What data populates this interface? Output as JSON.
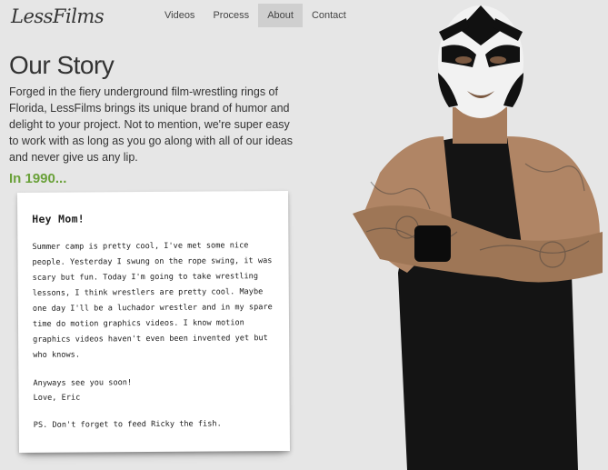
{
  "brand": {
    "logo_text": "LessFilms"
  },
  "nav": {
    "items": [
      {
        "label": "Videos",
        "active": false
      },
      {
        "label": "Process",
        "active": false
      },
      {
        "label": "About",
        "active": true
      },
      {
        "label": "Contact",
        "active": false
      }
    ]
  },
  "page": {
    "title": "Our Story",
    "intro": "Forged in the fiery underground film-wrestling rings of Florida, LessFilms brings its unique brand of humor and delight to your project. Not to mention, we're super easy to work with as long as you go along with all of our ideas and never give us any lip.",
    "year_heading": "In 1990..."
  },
  "letter": {
    "greeting": "Hey Mom!",
    "body": "Summer camp is pretty cool, I've met some nice people. Yesterday I swung on the rope swing, it was scary but fun. Today I'm going to take wrestling lessons, I think wrestlers are pretty cool. Maybe one day I'll be a luchador wrestler and in my spare time do motion graphics videos. I know motion graphics videos haven't even been invented yet but who knows.",
    "closing": "Anyways see you soon!",
    "signature": "Love, Eric",
    "ps": "PS. Don't forget to feed Ricky the fish."
  },
  "colors": {
    "accent_green": "#6aa13a",
    "background": "#e6e6e6",
    "nav_active_bg": "#cfcfcf"
  },
  "hero": {
    "image": "masked-luchador-wrestler-photo"
  }
}
